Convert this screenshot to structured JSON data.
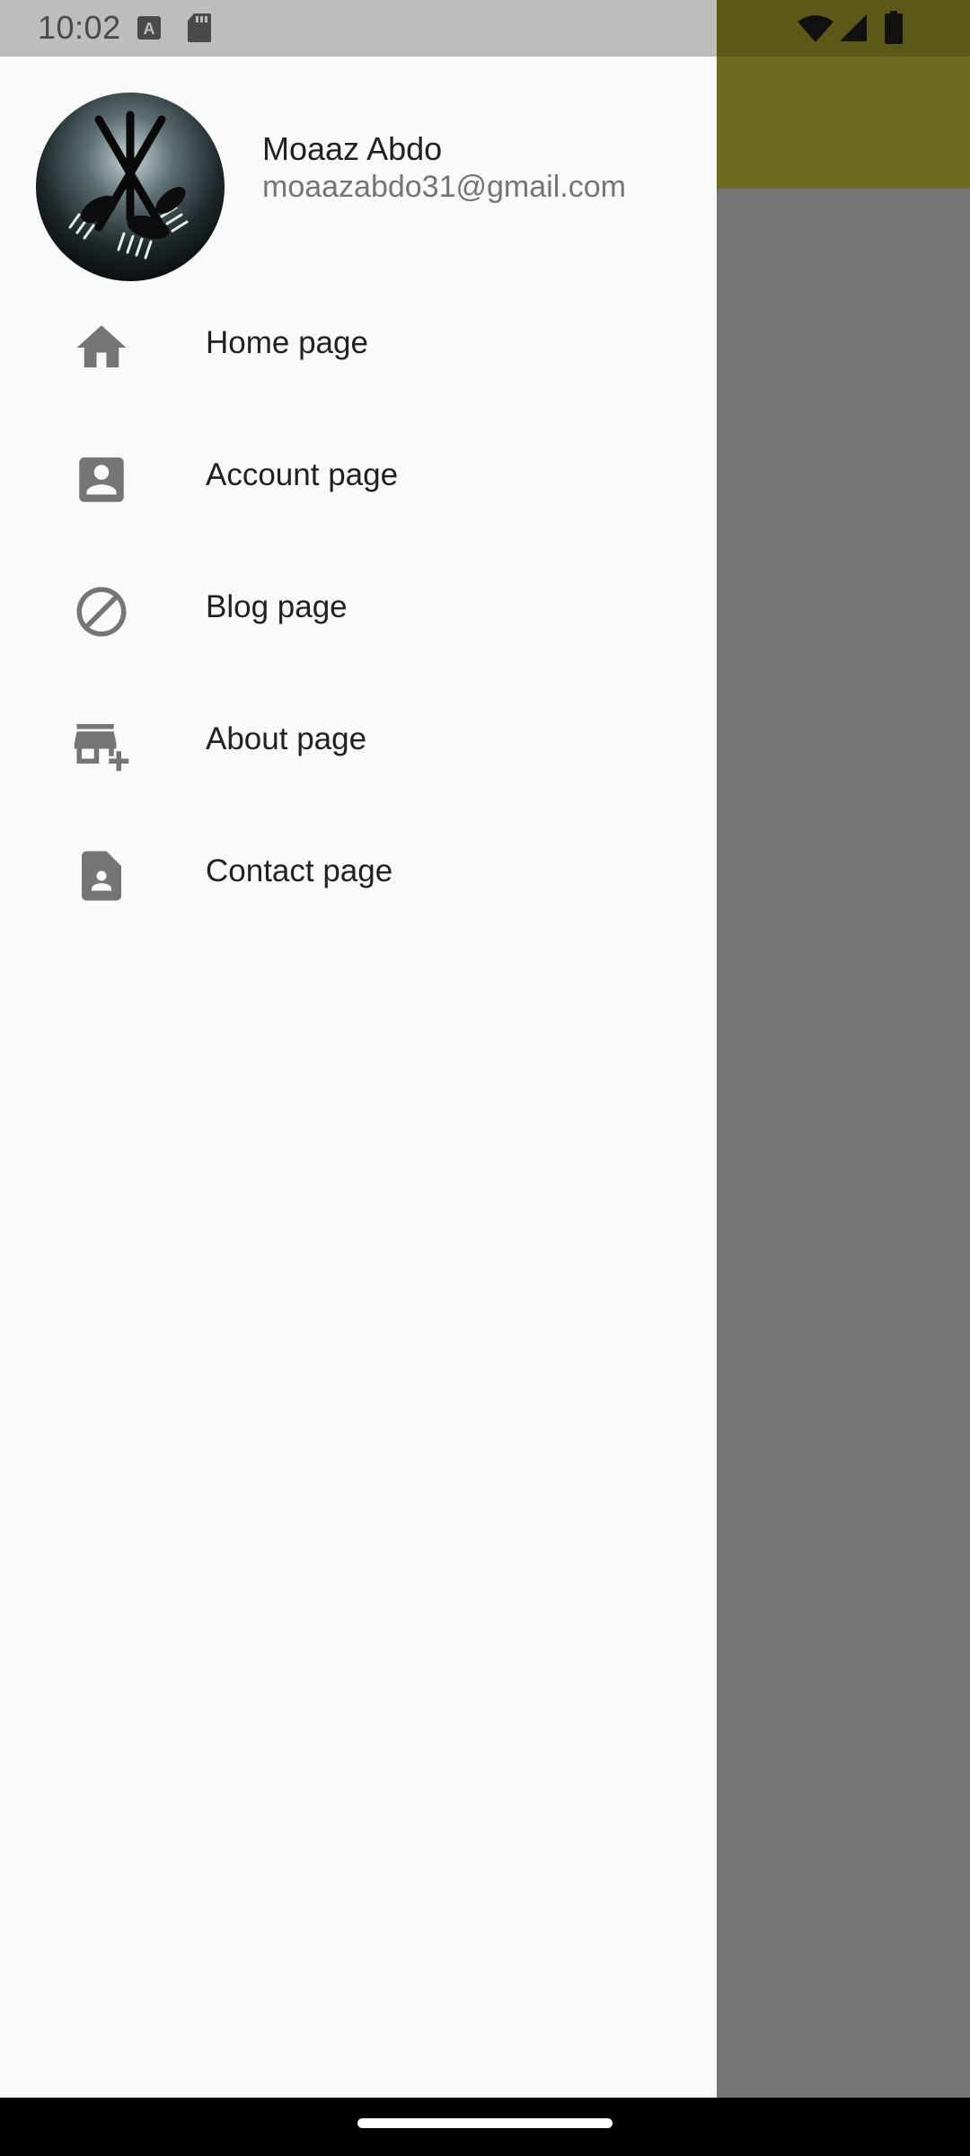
{
  "status_bar": {
    "time": "10:02",
    "left_icons": [
      "text-a-icon",
      "sd-card-icon"
    ],
    "right_icons": [
      "wifi-icon",
      "signal-icon",
      "battery-icon"
    ]
  },
  "drawer": {
    "header": {
      "name": "Moaaz Abdo",
      "email": "moaazabdo31@gmail.com",
      "avatar_icon": "avatar-forks-image"
    },
    "items": [
      {
        "label": "Home page",
        "icon": "home-icon"
      },
      {
        "label": "Account page",
        "icon": "account-box-icon"
      },
      {
        "label": "Blog page",
        "icon": "block-icon"
      },
      {
        "label": "About page",
        "icon": "add-business-icon"
      },
      {
        "label": "Contact page",
        "icon": "contact-page-icon"
      }
    ]
  },
  "colors": {
    "app_bar": "#6e6a1f",
    "scrim": "#757575",
    "drawer_bg": "#fafafa",
    "icon_gray": "#757575"
  }
}
